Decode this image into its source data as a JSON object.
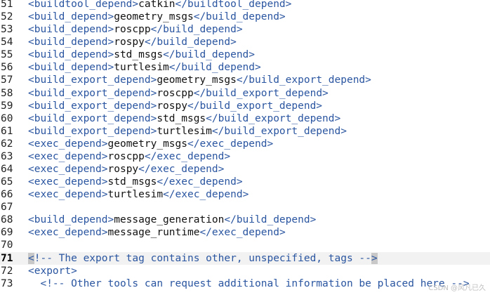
{
  "editor": {
    "lines": [
      {
        "num": "51",
        "open": "<buildtool_depend>",
        "value": "catkin",
        "close": "</buildtool_depend>"
      },
      {
        "num": "52",
        "open": "<build_depend>",
        "value": "geometry_msgs",
        "close": "</build_depend>"
      },
      {
        "num": "53",
        "open": "<build_depend>",
        "value": "roscpp",
        "close": "</build_depend>"
      },
      {
        "num": "54",
        "open": "<build_depend>",
        "value": "rospy",
        "close": "</build_depend>"
      },
      {
        "num": "55",
        "open": "<build_depend>",
        "value": "std_msgs",
        "close": "</build_depend>"
      },
      {
        "num": "56",
        "open": "<build_depend>",
        "value": "turtlesim",
        "close": "</build_depend>"
      },
      {
        "num": "57",
        "open": "<build_export_depend>",
        "value": "geometry_msgs",
        "close": "</build_export_depend>"
      },
      {
        "num": "58",
        "open": "<build_export_depend>",
        "value": "roscpp",
        "close": "</build_export_depend>"
      },
      {
        "num": "59",
        "open": "<build_export_depend>",
        "value": "rospy",
        "close": "</build_export_depend>"
      },
      {
        "num": "60",
        "open": "<build_export_depend>",
        "value": "std_msgs",
        "close": "</build_export_depend>"
      },
      {
        "num": "61",
        "open": "<build_export_depend>",
        "value": "turtlesim",
        "close": "</build_export_depend>"
      },
      {
        "num": "62",
        "open": "<exec_depend>",
        "value": "geometry_msgs",
        "close": "</exec_depend>"
      },
      {
        "num": "63",
        "open": "<exec_depend>",
        "value": "roscpp",
        "close": "</exec_depend>"
      },
      {
        "num": "64",
        "open": "<exec_depend>",
        "value": "rospy",
        "close": "</exec_depend>"
      },
      {
        "num": "65",
        "open": "<exec_depend>",
        "value": "std_msgs",
        "close": "</exec_depend>"
      },
      {
        "num": "66",
        "open": "<exec_depend>",
        "value": "turtlesim",
        "close": "</exec_depend>"
      },
      {
        "num": "67",
        "open": "",
        "value": "",
        "close": ""
      },
      {
        "num": "68",
        "open": "<build_depend>",
        "value": "message_generation",
        "close": "</build_depend>"
      },
      {
        "num": "69",
        "open": "<exec_depend>",
        "value": "message_runtime",
        "close": "</exec_depend>"
      },
      {
        "num": "70",
        "open": "",
        "value": "",
        "close": ""
      },
      {
        "num": "71",
        "comment_lt": "<",
        "comment_body": "!-- The export tag contains other, unspecified, tags --",
        "comment_gt": ">",
        "current": true
      },
      {
        "num": "72",
        "open": "<export>",
        "value": "",
        "close": ""
      },
      {
        "num": "73",
        "indent": "  ",
        "comment": "<!-- Other tools can request additional information be placed here -->"
      }
    ]
  },
  "watermark": "CSDN @风凡已久",
  "colors": {
    "tag": "#2a55a0",
    "text": "#111111",
    "current_line_bg": "#f2f2f2"
  }
}
